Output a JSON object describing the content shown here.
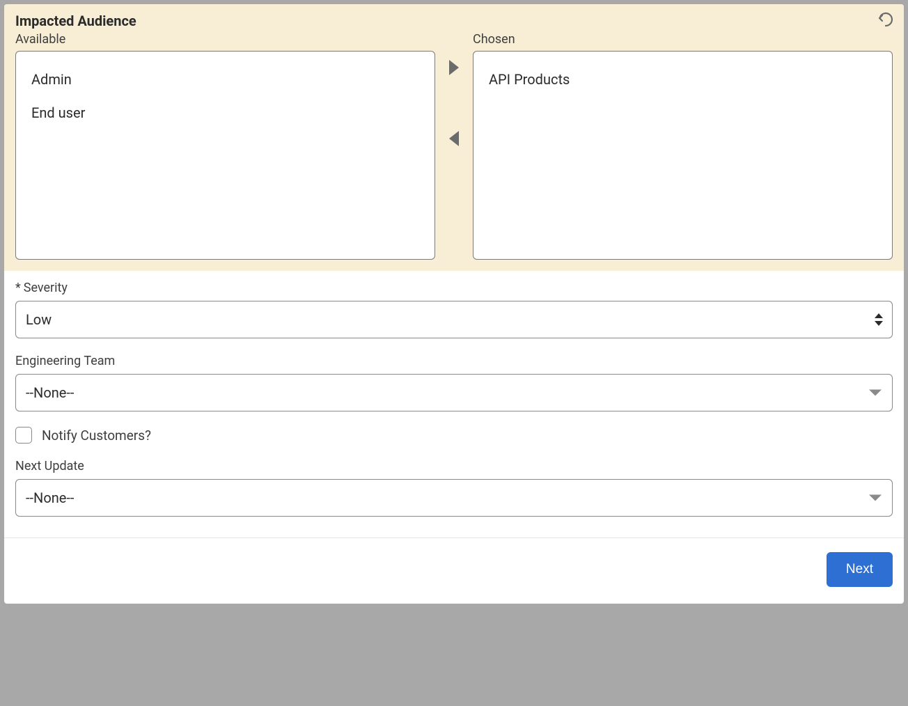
{
  "audience": {
    "title": "Impacted Audience",
    "available_label": "Available",
    "chosen_label": "Chosen",
    "available_items": [
      "Admin",
      "End user"
    ],
    "chosen_items": [
      "API Products"
    ]
  },
  "fields": {
    "severity": {
      "label": "Severity",
      "required_marker": "*",
      "value": "Low"
    },
    "engineering_team": {
      "label": "Engineering Team",
      "value": "--None--"
    },
    "notify_customers": {
      "label": "Notify Customers?",
      "checked": false
    },
    "next_update": {
      "label": "Next Update",
      "value": "--None--"
    }
  },
  "footer": {
    "next_label": "Next"
  }
}
